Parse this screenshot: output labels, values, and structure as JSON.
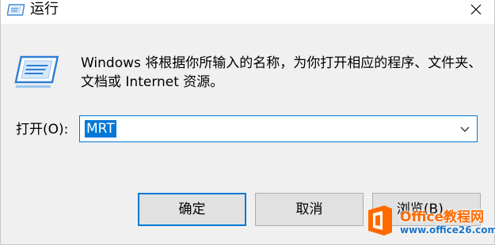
{
  "window": {
    "title": "运行",
    "icon": "run-icon",
    "close_icon": "close-icon"
  },
  "description": "Windows 将根据你所输入的名称，为你打开相应的程序、文件夹、文档或 Internet 资源。",
  "open_field": {
    "label": "打开(O):",
    "value": "MRT",
    "selected": true,
    "dropdown_icon": "chevron-down-icon"
  },
  "buttons": {
    "ok": "确定",
    "cancel": "取消",
    "browse": "浏览(B)..."
  },
  "watermark": {
    "line1": "Office教程网",
    "line2": "www.office26.com"
  },
  "colors": {
    "accent": "#0078d7",
    "dialog_bg": "#f0f0f0",
    "watermark_orange": "#ff6a00",
    "watermark_blue": "#1a73c8"
  }
}
